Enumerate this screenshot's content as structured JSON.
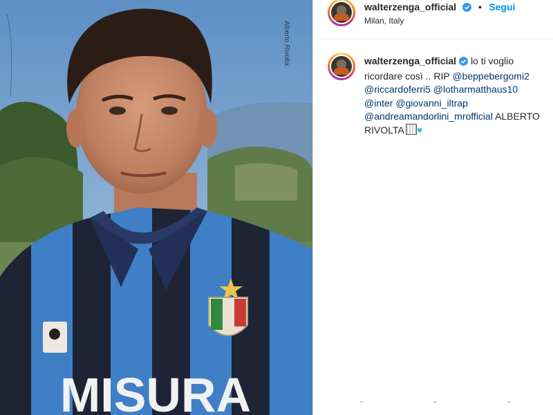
{
  "post": {
    "image_alt": "Vintage team photo of a footballer in a blue and black striped jersey",
    "photo_signature": "Alberto Rivolta",
    "shirt_sponsor": "MISURA"
  },
  "header": {
    "username": "walterzenga_official",
    "separator": "•",
    "follow_label": "Segui",
    "location": "Milan, Italy"
  },
  "caption": {
    "username": "walterzenga_official",
    "text_1": "lo ti voglio ricordare così .. RIP",
    "mention_1": "@beppebergomi2",
    "mention_2": "@riccardoferri5",
    "mention_3": "@lotharmatthaus10",
    "mention_4": "@inter",
    "mention_5": "@giovanni_iltrap",
    "mention_6": "@andreamandorlini_mrofficial",
    "text_2": "ALBERTO RIVOLTA"
  },
  "colors": {
    "accent": "#0095f6",
    "text": "#262626",
    "mention": "#00376b",
    "verified": "#3897f0",
    "heart": "#27c2d4"
  },
  "icons": [
    "verified-badge-icon",
    "flag-emoji-icon",
    "heart-emoji-icon"
  ]
}
